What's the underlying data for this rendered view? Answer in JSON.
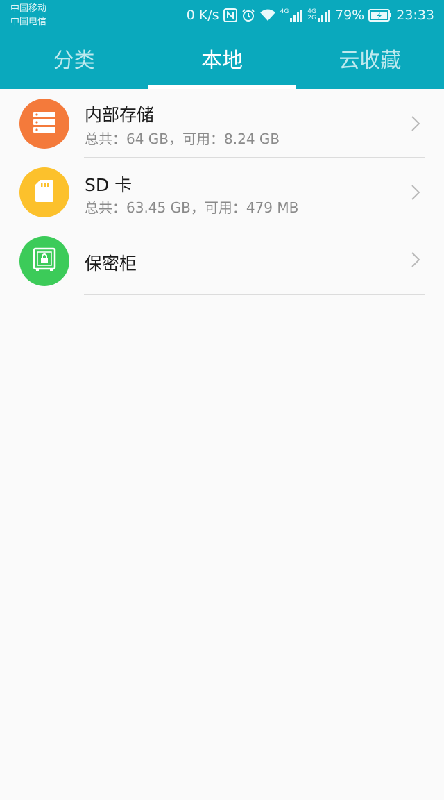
{
  "status_bar": {
    "carrier_1": "中国移动",
    "carrier_2": "中国电信",
    "net_speed": "0 K/s",
    "sim1_tag": "4G",
    "sim2_tag_top": "4G",
    "sim2_tag_bottom": "2G",
    "battery_percent": "79%",
    "time": "23:33"
  },
  "tabs": [
    {
      "label": "分类",
      "active": false
    },
    {
      "label": "本地",
      "active": true
    },
    {
      "label": "云收藏",
      "active": false
    }
  ],
  "storage_list": [
    {
      "title": "内部存储",
      "subtitle": "总共：64 GB，可用：8.24 GB",
      "icon": "server-storage-icon",
      "color": "#f47a3b"
    },
    {
      "title": "SD 卡",
      "subtitle": "总共：63.45 GB，可用：479 MB",
      "icon": "sd-card-icon",
      "color": "#fcc12c"
    },
    {
      "title": "保密柜",
      "subtitle": "",
      "icon": "safe-lock-icon",
      "color": "#3ccb59"
    }
  ],
  "colors": {
    "header": "#0aa9bd",
    "background": "#fafafa"
  }
}
